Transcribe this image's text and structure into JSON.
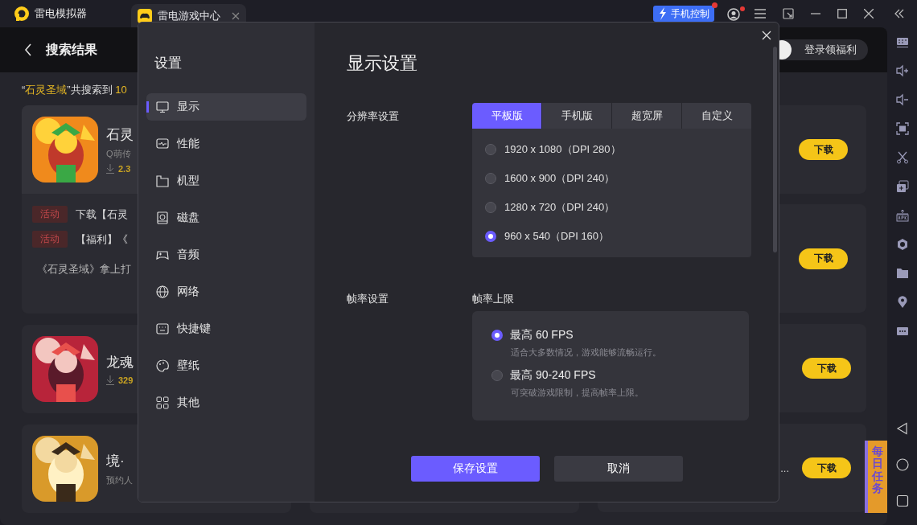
{
  "title_bar": {
    "app_name": "雷电模拟器",
    "tab": {
      "label": "雷电游戏中心"
    },
    "phone_control": {
      "label": "手机控制",
      "notification": true
    },
    "account_notification": true
  },
  "header": {
    "title": "搜索结果",
    "login_label": "登录领福利"
  },
  "result_summary": [
    {
      "text": "“",
      "highlight": false
    },
    {
      "text": "石灵圣域",
      "highlight": true
    },
    {
      "text": "”共搜索到 ",
      "highlight": false
    },
    {
      "text": "10",
      "highlight": true
    }
  ],
  "results": {
    "column_1": [
      {
        "title": "石灵",
        "subtitle": "Q萌传",
        "downloads": "2.3",
        "activities": [
          {
            "tag": "活动",
            "text": "下载【石灵"
          },
          {
            "tag": "活动",
            "text": "【福利】《"
          }
        ],
        "note": "《石灵圣域》拿上打"
      },
      {
        "title": "龙魂",
        "downloads": "329"
      },
      {
        "title": "境·",
        "subtitle": "预约人"
      }
    ],
    "column_3": [
      {
        "button": "下载"
      },
      {
        "button": "下载"
      },
      {
        "button": "下载"
      },
      {
        "button": "下载",
        "overflow_text": "..."
      }
    ]
  },
  "daily_badge": {
    "label": "每日任务"
  },
  "settings": {
    "title": "设置",
    "nav": [
      {
        "label": "显示",
        "selected": true
      },
      {
        "label": "性能",
        "selected": false
      },
      {
        "label": "机型",
        "selected": false
      },
      {
        "label": "磁盘",
        "selected": false
      },
      {
        "label": "音频",
        "selected": false
      },
      {
        "label": "网络",
        "selected": false
      },
      {
        "label": "快捷键",
        "selected": false
      },
      {
        "label": "壁纸",
        "selected": false
      },
      {
        "label": "其他",
        "selected": false
      }
    ],
    "page_title": "显示设置",
    "resolution": {
      "label": "分辨率设置",
      "tabs": [
        {
          "label": "平板版",
          "selected": true
        },
        {
          "label": "手机版",
          "selected": false
        },
        {
          "label": "超宽屏",
          "selected": false
        },
        {
          "label": "自定义",
          "selected": false
        }
      ],
      "options": [
        {
          "label": "1920 x 1080（DPI 280）",
          "selected": false
        },
        {
          "label": "1600 x 900（DPI 240）",
          "selected": false
        },
        {
          "label": "1280 x 720（DPI 240）",
          "selected": false
        },
        {
          "label": "960 x 540（DPI 160）",
          "selected": true
        }
      ]
    },
    "frame_rate": {
      "label": "帧率设置",
      "sublabel": "帧率上限",
      "options": [
        {
          "label": "最高 60 FPS",
          "description": "适合大多数情况，游戏能够流畅运行。",
          "selected": true
        },
        {
          "label": "最高 90-240 FPS",
          "description": "可突破游戏限制，提高帧率上限。",
          "selected": false
        }
      ]
    },
    "buttons": [
      {
        "label": "保存设置",
        "kind": "primary"
      },
      {
        "label": "取消",
        "kind": "secondary"
      }
    ]
  }
}
